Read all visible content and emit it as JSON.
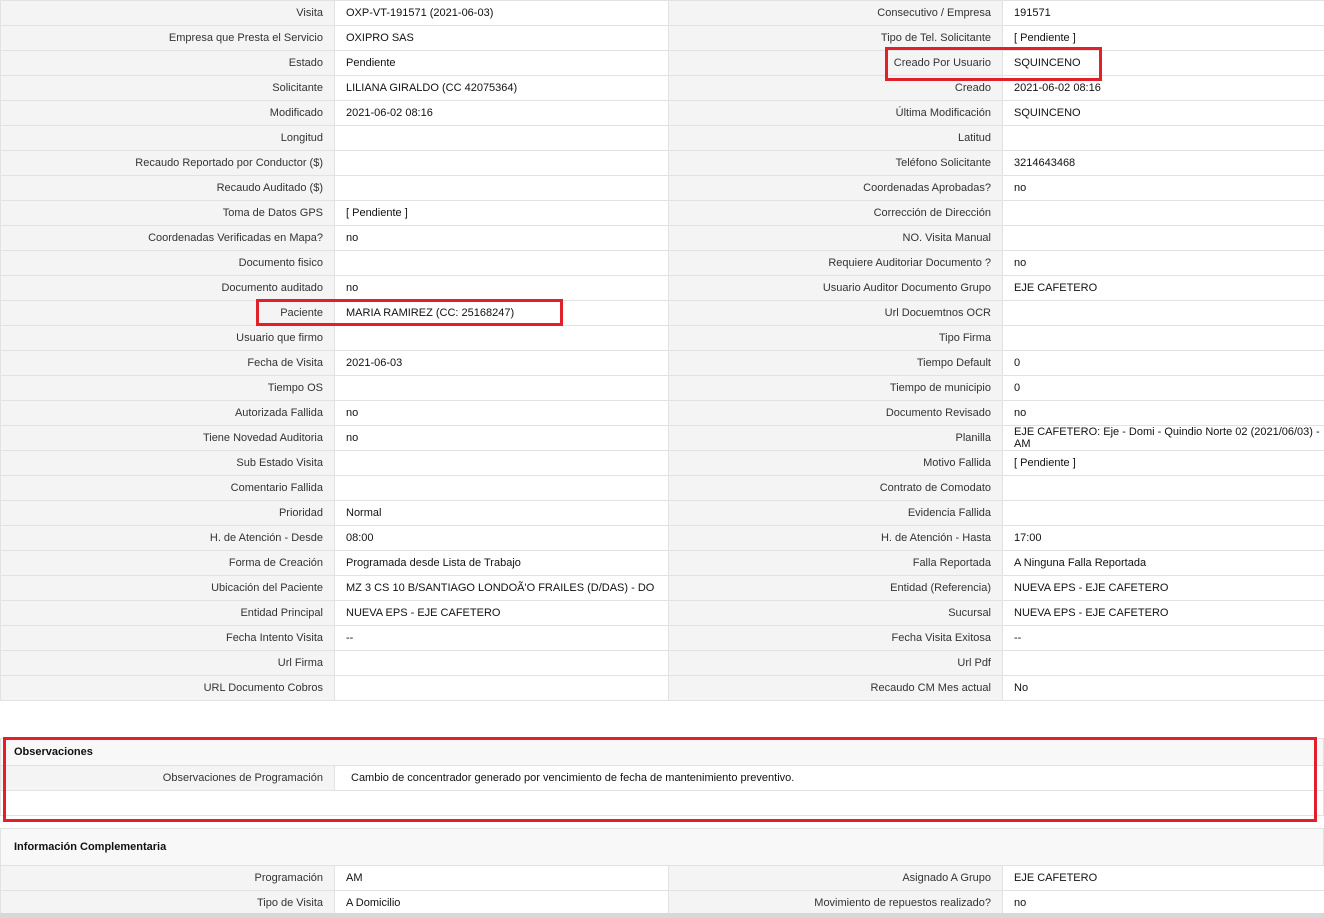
{
  "main_rows": [
    {
      "l1": "Visita",
      "v1": "OXP-VT-191571 (2021-06-03)",
      "l2": "Consecutivo / Empresa",
      "v2": "191571"
    },
    {
      "l1": "Empresa que Presta el Servicio",
      "v1": "OXIPRO SAS",
      "l2": "Tipo de Tel. Solicitante",
      "v2": "[ Pendiente ]"
    },
    {
      "l1": "Estado",
      "v1": "Pendiente",
      "l2": "Creado Por Usuario",
      "v2": "SQUINCENO"
    },
    {
      "l1": "Solicitante",
      "v1": "LILIANA GIRALDO (CC 42075364)",
      "l2": "Creado",
      "v2": "2021-06-02 08:16"
    },
    {
      "l1": "Modificado",
      "v1": "2021-06-02 08:16",
      "l2": "Última Modificación",
      "v2": " SQUINCENO"
    },
    {
      "l1": "Longitud",
      "v1": "",
      "l2": "Latitud",
      "v2": ""
    },
    {
      "l1": "Recaudo Reportado por Conductor ($)",
      "v1": "",
      "l2": "Teléfono Solicitante",
      "v2": "3214643468"
    },
    {
      "l1": "Recaudo Auditado ($)",
      "v1": "",
      "l2": "Coordenadas Aprobadas?",
      "v2": " no"
    },
    {
      "l1": "Toma de Datos GPS",
      "v1": "[ Pendiente ]",
      "l2": "Corrección de Dirección",
      "v2": ""
    },
    {
      "l1": "Coordenadas Verificadas en Mapa?",
      "v1": " no",
      "l2": "NO. Visita Manual",
      "v2": ""
    },
    {
      "l1": "Documento fisico",
      "v1": "",
      "l2": "Requiere Auditoriar Documento ?",
      "v2": " no"
    },
    {
      "l1": "Documento auditado",
      "v1": "no",
      "l2": "Usuario Auditor Documento Grupo",
      "v2": "EJE CAFETERO"
    },
    {
      "l1": "Paciente",
      "v1": "MARIA RAMIREZ (CC: 25168247)",
      "l2": "Url Docuemtnos OCR",
      "v2": ""
    },
    {
      "l1": "Usuario que firmo",
      "v1": "",
      "l2": "Tipo Firma",
      "v2": ""
    },
    {
      "l1": "Fecha de Visita",
      "v1": " 2021-06-03",
      "l2": "Tiempo Default",
      "v2": "0"
    },
    {
      "l1": "Tiempo OS",
      "v1": "",
      "l2": "Tiempo de municipio",
      "v2": "0"
    },
    {
      "l1": "Autorizada Fallida",
      "v1": " no",
      "l2": "Documento Revisado",
      "v2": " no"
    },
    {
      "l1": "Tiene Novedad Auditoria",
      "v1": " no",
      "l2": "Planilla",
      "v2": "EJE CAFETERO: Eje - Domi - Quindio Norte 02 (2021/06/03) - AM"
    },
    {
      "l1": "Sub Estado Visita",
      "v1": "",
      "l2": "Motivo Fallida",
      "v2": "[ Pendiente ]"
    },
    {
      "l1": "Comentario Fallida",
      "v1": "",
      "l2": "Contrato de Comodato",
      "v2": ""
    },
    {
      "l1": "Prioridad",
      "v1": "Normal",
      "l2": "Evidencia Fallida",
      "v2": ""
    },
    {
      "l1": "H. de Atención - Desde",
      "v1": "08:00",
      "l2": "H. de Atención - Hasta",
      "v2": "17:00"
    },
    {
      "l1": "Forma de Creación",
      "v1": "Programada desde Lista de Trabajo",
      "l2": "Falla Reportada",
      "v2": "A Ninguna Falla Reportada"
    },
    {
      "l1": "Ubicación del Paciente",
      "v1": "MZ 3 CS 10 B/SANTIAGO LONDOÃ'O FRAILES (D/DAS) - DO",
      "l2": "Entidad (Referencia)",
      "v2": "NUEVA EPS - EJE CAFETERO"
    },
    {
      "l1": "Entidad Principal",
      "v1": "NUEVA EPS - EJE CAFETERO",
      "l2": "Sucursal",
      "v2": "NUEVA EPS - EJE CAFETERO"
    },
    {
      "l1": "Fecha Intento Visita",
      "v1": " --",
      "l2": "Fecha Visita Exitosa",
      "v2": " --"
    },
    {
      "l1": "Url Firma",
      "v1": "",
      "l2": "Url Pdf",
      "v2": ""
    },
    {
      "l1": "URL Documento Cobros",
      "v1": "",
      "l2": "Recaudo CM Mes actual",
      "v2": "No"
    }
  ],
  "observaciones": {
    "title": "Observaciones",
    "label": "Observaciones de Programación",
    "value": "Cambio de concentrador generado por vencimiento de fecha de mantenimiento preventivo."
  },
  "complementaria": {
    "title": "Información Complementaria",
    "rows": [
      {
        "l1": "Programación",
        "v1": "AM",
        "l2": "Asignado A Grupo",
        "v2": "EJE CAFETERO"
      },
      {
        "l1": "Tipo de Visita",
        "v1": "A Domicilio",
        "l2": "Movimiento de repuestos realizado?",
        "v2": " no"
      }
    ]
  },
  "colors": {
    "highlight": "#e0202a",
    "label_bg": "#f4f4f4",
    "border": "#e2e2e2"
  }
}
